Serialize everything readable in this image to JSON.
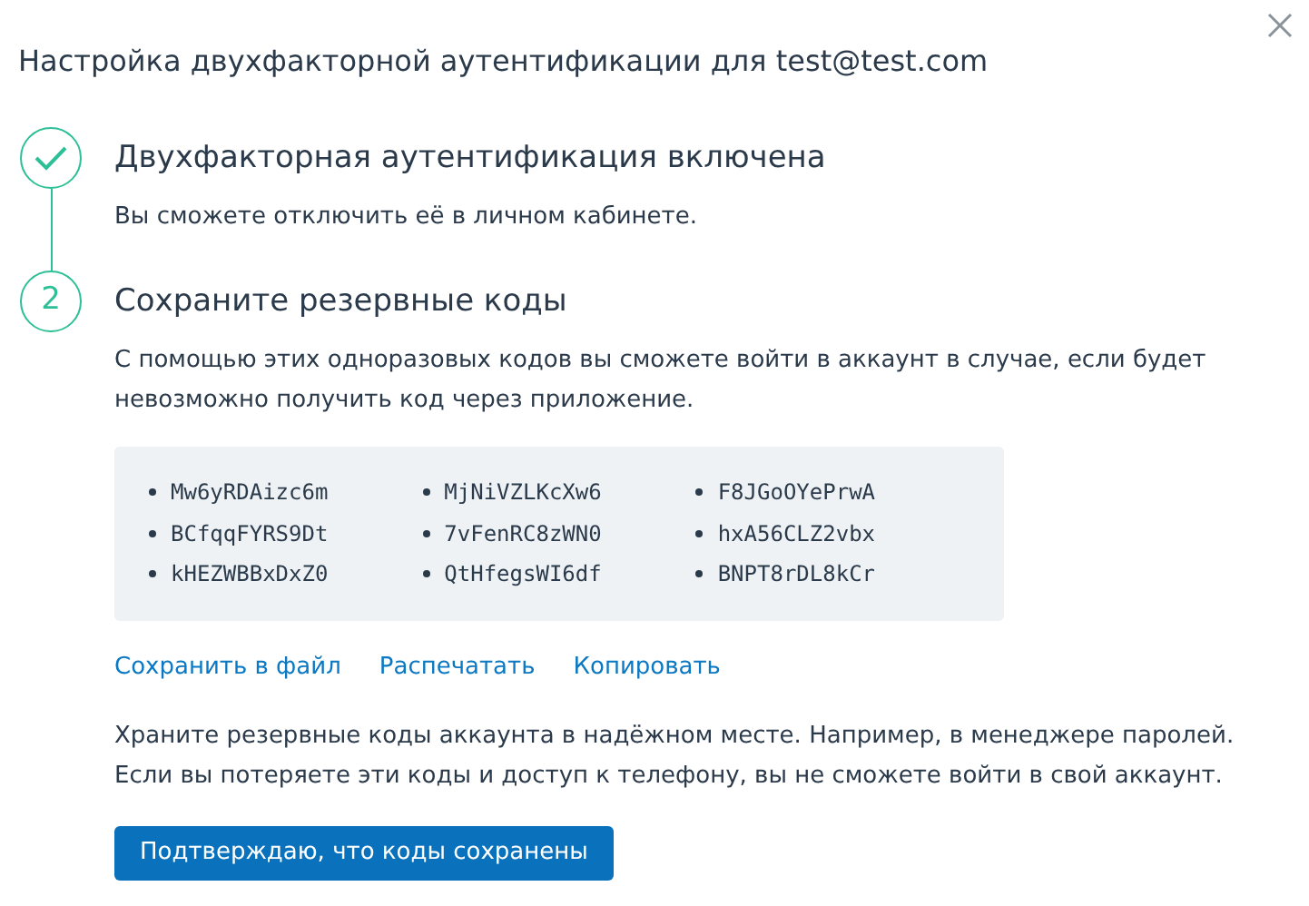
{
  "title": "Настройка двухфакторной аутентификации для test@test.com",
  "steps": [
    {
      "kind": "done",
      "heading": "Двухфакторная аутентификация включена",
      "text": "Вы сможете отключить её в личном кабинете."
    },
    {
      "kind": "number",
      "label": "2",
      "heading": "Сохраните резервные коды",
      "text": "С помощью этих одноразовых кодов вы сможете войти в аккаунт в случае, если будет невозможно получить код через приложение."
    }
  ],
  "code_columns": [
    [
      "Mw6yRDAizc6m",
      "BCfqqFYRS9Dt",
      "kHEZWBBxDxZ0"
    ],
    [
      "MjNiVZLKcXw6",
      "7vFenRC8zWN0",
      "QtHfegsWI6df"
    ],
    [
      "F8JGoOYePrwA",
      "hxA56CLZ2vbx",
      "BNPT8rDL8kCr"
    ]
  ],
  "links": [
    "Сохранить в файл",
    "Распечатать",
    "Копировать"
  ],
  "note": "Храните резервные коды аккаунта в надёжном месте. Например, в менеджере паролей. Если вы потеряете эти коды и доступ к телефону, вы не сможете войти в свой аккаунт.",
  "confirm_button": "Подтверждаю, что коды сохранены"
}
